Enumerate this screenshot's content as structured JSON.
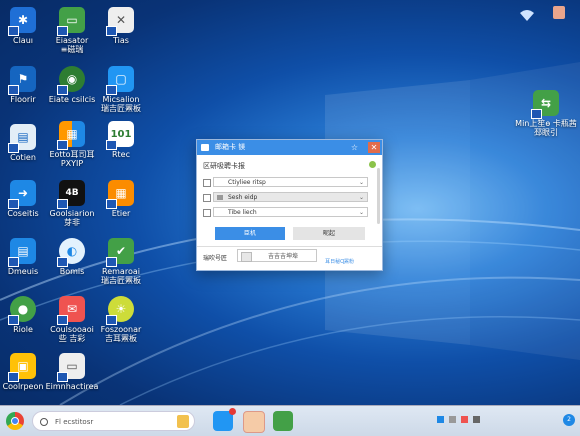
{
  "colors": {
    "dialog_title_bg": "#3b8ee6",
    "dialog_close": "#e06c4b",
    "taskbar_bg": "#dfe8f3"
  },
  "desktop": {
    "icons": [
      {
        "label": "Clauı",
        "icon": "gear-icon",
        "color": "#1f6fd6"
      },
      {
        "label": "Eiasator\n≡磁瑞",
        "icon": "monitor-icon",
        "color": "#43a047"
      },
      {
        "label": "Tias",
        "icon": "close-box-icon",
        "color": "#eeeeee"
      },
      {
        "label": "Floorir",
        "icon": "network-icon",
        "color": "#1565c0"
      },
      {
        "label": "Eiate csilcis",
        "icon": "globe-icon",
        "color": "#2e7d32"
      },
      {
        "label": "Micsalion\n瑞吉匠罴板",
        "icon": "app-window-icon",
        "color": "#2196f3"
      },
      {
        "label": "Cotien",
        "icon": "document-icon",
        "color": "#e3eef7"
      },
      {
        "label": "Eotto耳司耳 PXYIP",
        "icon": "windows-logo-icon",
        "color": "#ff9800"
      },
      {
        "label": "Rtec",
        "icon": "binary-icon",
        "color": "#ffffff"
      },
      {
        "label": "Coseitis",
        "icon": "arrow-icon",
        "color": "#1e88e5"
      },
      {
        "label": "Goolsiarion\n芽非",
        "icon": "4k-icon",
        "color": "#111111"
      },
      {
        "label": "Etier",
        "icon": "table-icon",
        "color": "#fb8c00"
      },
      {
        "label": "Dmeuis",
        "icon": "file-icon",
        "color": "#1e88e5"
      },
      {
        "label": "Bomis",
        "icon": "circle-logo-icon",
        "color": "#e3f2fd"
      },
      {
        "label": "Remaroai\n瑞吉匠罴板",
        "icon": "checkmark-icon",
        "color": "#43a047"
      },
      {
        "label": "Riole",
        "icon": "chat-icon",
        "color": "#43a047"
      },
      {
        "label": "Coulsooaoi\n些 吉彩",
        "icon": "mail-icon",
        "color": "#ef5350"
      },
      {
        "label": "Foszoonar\n吉耳罴板",
        "icon": "lightbulb-icon",
        "color": "#cddc39"
      },
      {
        "label": "Coolrpeon",
        "icon": "folders-icon",
        "color": "#ffc107"
      },
      {
        "label": "Eimnhactirea",
        "icon": "pc-icon",
        "color": "#eeeeee"
      },
      {
        "label": "Min上笙ѳ 卡瓶茜\n邳眼引",
        "icon": "network-share-icon",
        "color": "#43a047"
      }
    ]
  },
  "dialog": {
    "title": "邮箱卡 镁",
    "header": "区研吸聘卡报",
    "options": [
      {
        "label": "Ctiyliee ritsp"
      },
      {
        "label": "Sesh eidp"
      },
      {
        "label": "Tibe liech"
      }
    ],
    "ok_label": "臣机",
    "cancel_label": "昵起",
    "footer_label": "瑞吹号匠",
    "footer_value": "吉吉吉坤埠",
    "footer_link": "耳日秘Ɋ罴粉"
  },
  "taskbar": {
    "search_placeholder": "Fl ecstitosr",
    "tray_badge": "2"
  }
}
